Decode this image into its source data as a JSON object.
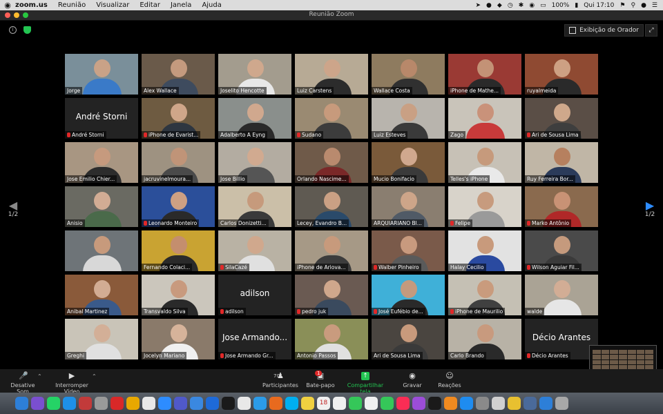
{
  "menubar": {
    "items": [
      "zoom.us",
      "Reunião",
      "Visualizar",
      "Editar",
      "Janela",
      "Ajuda"
    ],
    "battery": "100%",
    "clock": "Qui 17:10"
  },
  "window": {
    "title": "Reunião Zoom"
  },
  "top": {
    "view_label": "Exibição de Orador"
  },
  "pager": {
    "left": "1/2",
    "right": "1/2"
  },
  "tiles": [
    {
      "name": "Jorge",
      "muted": false,
      "video": true,
      "bg": "#7a8f9a",
      "skin": "#c9a287",
      "shirt": "#3a7ac8"
    },
    {
      "name": "Alex Wallace",
      "muted": false,
      "video": true,
      "bg": "#6a5a4a",
      "skin": "#c49a7e",
      "shirt": "#3e4b5e"
    },
    {
      "name": "Joselito Hencotte",
      "muted": false,
      "video": true,
      "bg": "#a39c8e",
      "skin": "#cfa88d",
      "shirt": "#e8e8e8"
    },
    {
      "name": "Luiz Carstens",
      "muted": false,
      "video": true,
      "bg": "#b7aa95",
      "skin": "#cda58a",
      "shirt": "#2c2c2c"
    },
    {
      "name": "Wallace Costa",
      "muted": false,
      "video": true,
      "bg": "#8e7b5f",
      "skin": "#b8886a",
      "shirt": "#303030"
    },
    {
      "name": "iPhone de Mathe...",
      "muted": false,
      "video": true,
      "bg": "#9a3a34",
      "skin": "#c39276",
      "shirt": "#2a2a2a"
    },
    {
      "name": "ruyalmeida",
      "muted": false,
      "video": true,
      "bg": "#8f4a32",
      "skin": "#cda083",
      "shirt": "#2a2a2a"
    },
    {
      "name": "André Storni",
      "muted": true,
      "video": false,
      "big": "André Storni"
    },
    {
      "name": "iPhone de Evarist...",
      "muted": true,
      "video": true,
      "bg": "#6e5b41",
      "skin": "#cfa689",
      "shirt": "#2e3640"
    },
    {
      "name": "Adalberto A Eyng",
      "muted": false,
      "video": true,
      "active": true,
      "bg": "#8a8f8c",
      "skin": "#d0a88e",
      "shirt": "#2a2a2a"
    },
    {
      "name": "Sudano",
      "muted": true,
      "video": true,
      "bg": "#9a8a72",
      "skin": "#c79a7c",
      "shirt": "#3c3c3c"
    },
    {
      "name": "Luiz Esteves",
      "muted": false,
      "video": true,
      "bg": "#b8b4ad",
      "skin": "#c9a084",
      "shirt": "#3a3a3a"
    },
    {
      "name": "Zago",
      "muted": false,
      "video": true,
      "bg": "#c9c4ba",
      "skin": "#c9927a",
      "shirt": "#c83a3a"
    },
    {
      "name": "Ari de Sousa Lima",
      "muted": true,
      "video": true,
      "bg": "#5a4e46",
      "skin": "#cfa88b",
      "shirt": "#3e3e3e"
    },
    {
      "name": "Jose Emilio Chier...",
      "muted": false,
      "video": true,
      "bg": "#a89682",
      "skin": "#c69a7e",
      "shirt": "#2c2c2c"
    },
    {
      "name": "jacruvinelmoura...",
      "muted": false,
      "video": true,
      "bg": "#9e9281",
      "skin": "#c09478",
      "shirt": "#4a4a4a"
    },
    {
      "name": "Jose Billio",
      "muted": false,
      "video": true,
      "bg": "#b3aca1",
      "skin": "#d1aa90",
      "shirt": "#555555"
    },
    {
      "name": "Orlando Nascime...",
      "muted": false,
      "video": true,
      "bg": "#6f5a49",
      "skin": "#b98a6e",
      "shirt": "#7a2828"
    },
    {
      "name": "Mucio Bonifacio",
      "muted": false,
      "video": true,
      "bg": "#7a5a3a",
      "skin": "#d0a88e",
      "shirt": "#3a3a3a"
    },
    {
      "name": "Telles's iPhone",
      "muted": false,
      "video": true,
      "bg": "#c7c1b6",
      "skin": "#c69a7c",
      "shirt": "#e9e9e9"
    },
    {
      "name": "Ruy Ferreira Bor...",
      "muted": false,
      "video": true,
      "bg": "#c0b6a6",
      "skin": "#b6805f",
      "shirt": "#2b3b5a"
    },
    {
      "name": "Anisio",
      "muted": false,
      "video": true,
      "bg": "#6a6a62",
      "skin": "#d2ac94",
      "shirt": "#4a6a4a"
    },
    {
      "name": "Leonardo Monteiro",
      "muted": true,
      "video": true,
      "bg": "#2b4f9a",
      "skin": "#cda083",
      "shirt": "#2a2a2a"
    },
    {
      "name": "Carlos Donizetti...",
      "muted": false,
      "video": true,
      "bg": "#cbbfa8",
      "skin": "#c69a7c",
      "shirt": "#3a3a3a"
    },
    {
      "name": "Lecey, Evandro B...",
      "muted": false,
      "video": true,
      "bg": "#5f5a52",
      "skin": "#caa084",
      "shirt": "#2a4a6a"
    },
    {
      "name": "ARQUIARIANO Bl...",
      "muted": false,
      "video": true,
      "bg": "#8a7e70",
      "skin": "#cda589",
      "shirt": "#505a66"
    },
    {
      "name": "Felipe",
      "muted": true,
      "video": true,
      "bg": "#d8d3ca",
      "skin": "#c79b7e",
      "shirt": "#9a9a9a"
    },
    {
      "name": "Marko Antônio",
      "muted": true,
      "video": true,
      "bg": "#8a6a4e",
      "skin": "#c89275",
      "shirt": "#b02828"
    },
    {
      "name": "",
      "muted": false,
      "video": true,
      "bg": "#6e7478",
      "skin": "#c79a7c",
      "shirt": "#d8d8d8"
    },
    {
      "name": "Fernando Colaci...",
      "muted": false,
      "video": true,
      "bg": "#c9a332",
      "skin": "#c48e6e",
      "shirt": "#2a2a2a"
    },
    {
      "name": "SilaCazé",
      "muted": true,
      "video": true,
      "bg": "#b9b2a4",
      "skin": "#d0a88d",
      "shirt": "#e0e0e0"
    },
    {
      "name": "iPhone de Ariova...",
      "muted": false,
      "video": true,
      "bg": "#a69986",
      "skin": "#c79a7c",
      "shirt": "#3c3c3c"
    },
    {
      "name": "Walber Pinheiro",
      "muted": true,
      "video": true,
      "bg": "#7a5a4a",
      "skin": "#c89a7e",
      "shirt": "#5a5a5a"
    },
    {
      "name": "Halay Cecilio",
      "muted": false,
      "video": true,
      "bg": "#e2e2e2",
      "skin": "#c89a7c",
      "shirt": "#2a4aa0"
    },
    {
      "name": "Wilson Aguiar Fil...",
      "muted": true,
      "video": true,
      "bg": "#4a4a4a",
      "skin": "#c59a7d",
      "shirt": "#3a3a3a"
    },
    {
      "name": "Anibal Martinez",
      "muted": false,
      "video": true,
      "bg": "#8a5a3a",
      "skin": "#d2ac93",
      "shirt": "#3a5a8a"
    },
    {
      "name": "Transvaldo Silva",
      "muted": false,
      "video": true,
      "bg": "#cbc6bc",
      "skin": "#c89a7e",
      "shirt": "#2a2a2a"
    },
    {
      "name": "adilson",
      "muted": true,
      "video": false,
      "big": "adilson"
    },
    {
      "name": "pedro juk",
      "muted": true,
      "video": true,
      "bg": "#6a5a52",
      "skin": "#cfa78c",
      "shirt": "#3a4a5e"
    },
    {
      "name": "José Eufébio de...",
      "muted": true,
      "video": true,
      "bg": "#3fb0d8",
      "skin": "#c49a7e",
      "shirt": "#2a2a2a"
    },
    {
      "name": "iPhone de Maurilio",
      "muted": true,
      "video": true,
      "bg": "#c5c0b4",
      "skin": "#c99b7d",
      "shirt": "#404040"
    },
    {
      "name": "walde",
      "muted": false,
      "video": true,
      "bg": "#aaa395",
      "skin": "#d2ad95",
      "shirt": "#e6e6e6"
    },
    {
      "name": "Greghi",
      "muted": false,
      "video": true,
      "bg": "#c9c4b8",
      "skin": "#d3af97",
      "shirt": "#e0e0e0"
    },
    {
      "name": "Jocelyn Mariano",
      "muted": false,
      "video": true,
      "bg": "#8a7a6a",
      "skin": "#d6b39a",
      "shirt": "#f0f0f0"
    },
    {
      "name": "Jose Armando Gr...",
      "muted": true,
      "video": false,
      "big": "Jose Armando..."
    },
    {
      "name": "Antonio Passos",
      "muted": false,
      "video": true,
      "bg": "#8a8f58",
      "skin": "#c99b7e",
      "shirt": "#e0e0e0"
    },
    {
      "name": "Ari de Sousa Lima",
      "muted": false,
      "video": true,
      "bg": "#4a4540",
      "skin": "#c89a7c",
      "shirt": "#3a3a3a"
    },
    {
      "name": "Carlo Brando",
      "muted": false,
      "video": true,
      "bg": "#b8b2a6",
      "skin": "#c89a7e",
      "shirt": "#2a2a2a"
    },
    {
      "name": "Décio Arantes",
      "muted": true,
      "video": false,
      "big": "Décio Arantes"
    }
  ],
  "toolbar": {
    "mute": "Desative Som",
    "video": "Interromper Vídeo",
    "participants": "Participantes",
    "participants_count": "70",
    "chat": "Bate-papo",
    "chat_badge": "1",
    "share": "Compartilhar tela",
    "record": "Gravar",
    "reactions": "Reações"
  },
  "dock": {
    "calendar_day": "18",
    "icons": [
      "finder-icon",
      "siri-icon",
      "whatsapp-icon",
      "safari-icon",
      "photobooth-icon",
      "launchpad-icon",
      "v-app-icon",
      "b-app-icon",
      "popcorn-icon",
      "zoom-icon",
      "teams-icon",
      "mail-icon",
      "airmail-icon",
      "c6-icon",
      "chrome-icon",
      "safari2-icon",
      "firefox-icon",
      "skype-icon",
      "notes-icon",
      "calendar-icon",
      "reminders-icon",
      "messages-icon",
      "photos-icon",
      "facetime-icon",
      "music-icon",
      "podcasts-icon",
      "tv-icon",
      "books-icon",
      "appstore-icon",
      "preferences-icon",
      "screenshot-icon",
      "notes2-icon",
      "box-icon",
      "finder2-icon",
      "trash-icon"
    ],
    "colors": [
      "#2d7fd8",
      "#7a4fd0",
      "#25d366",
      "#1e90e8",
      "#c23a3a",
      "#9a9a9a",
      "#d82828",
      "#e8a800",
      "#e8e8e8",
      "#2d8cff",
      "#5059c9",
      "#3a88e0",
      "#1e6ad8",
      "#1a1a1a",
      "#e8e8e8",
      "#2b9be8",
      "#e86a1e",
      "#00aff0",
      "#f0d040",
      "#f0f0f0",
      "#f0f0f0",
      "#35c759",
      "#f0f0f0",
      "#35c759",
      "#fa2d55",
      "#9b4dd8",
      "#1a1a1a",
      "#f08a20",
      "#1e8cf0",
      "#8a8a8a",
      "#d0d0d0",
      "#e8c030",
      "#4a6a9a",
      "#2d7fd8",
      "#a8a8a8"
    ]
  }
}
